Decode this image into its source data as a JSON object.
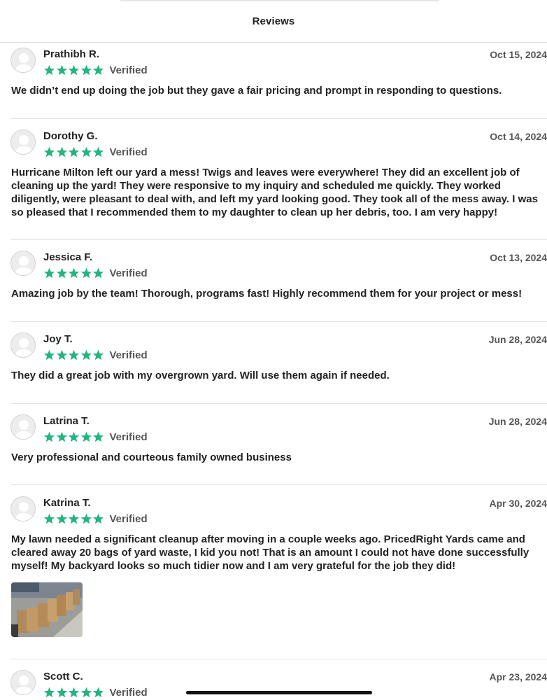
{
  "header": {
    "title": "Reviews"
  },
  "verified_label": "Verified",
  "star_color": "#24b47e",
  "reviews": [
    {
      "name": "Prathibh R.",
      "date": "Oct 15, 2024",
      "rating": 5,
      "text": "We didn’t end up doing the job but they gave a fair pricing and prompt in responding to questions."
    },
    {
      "name": "Dorothy G.",
      "date": "Oct 14, 2024",
      "rating": 5,
      "text": "Hurricane Milton left our yard a mess! Twigs and leaves were everywhere! They did an excellent job of cleaning up the yard! They were responsive to my inquiry and scheduled me quickly. They worked diligently, were pleasant to deal with, and left my yard looking good. They took all of the mess away. I was so pleased that I recommended them to my daughter to clean up her debris, too. I am very happy!"
    },
    {
      "name": "Jessica F.",
      "date": "Oct 13, 2024",
      "rating": 5,
      "text": "Amazing job by the team!  Thorough, programs fast!  Highly recommend them for your project or mess!"
    },
    {
      "name": "Joy T.",
      "date": "Jun 28, 2024",
      "rating": 5,
      "text": "They did a great job with my overgrown yard. Will use them again if needed."
    },
    {
      "name": "Latrina T.",
      "date": "Jun 28, 2024",
      "rating": 5,
      "text": "Very professional and courteous family owned business"
    },
    {
      "name": "Katrina T.",
      "date": "Apr 30, 2024",
      "rating": 5,
      "text": "My lawn needed a significant cleanup after moving in a couple weeks ago. PricedRight Yards came and cleared away 20 bags of yard waste, I kid you not! That is an amount I could not have done successfully myself! My backyard looks so much tidier now and I am very grateful for the job they did!",
      "photo": "yard-waste-bags-photo"
    },
    {
      "name": "Scott C.",
      "date": "Apr 23, 2024",
      "rating": 5,
      "text": ""
    }
  ]
}
